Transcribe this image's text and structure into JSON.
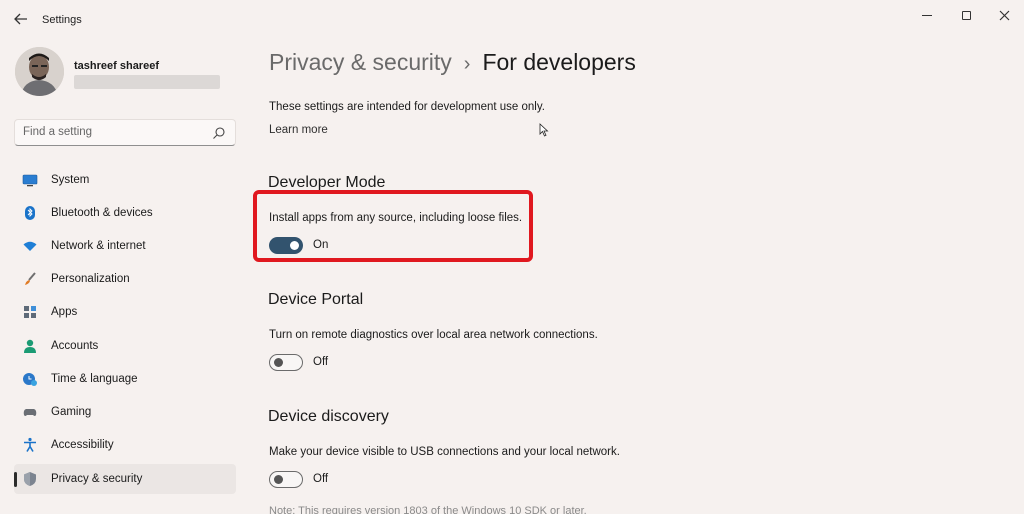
{
  "window": {
    "title": "Settings",
    "back_icon": "arrow-left-icon",
    "controls": [
      "minimize-icon",
      "maximize-icon",
      "close-icon"
    ]
  },
  "user": {
    "name": "tashreef shareef"
  },
  "search": {
    "placeholder": "Find a setting"
  },
  "sidebar": {
    "items": [
      {
        "label": "System",
        "icon": "monitor-icon"
      },
      {
        "label": "Bluetooth & devices",
        "icon": "bluetooth-icon"
      },
      {
        "label": "Network & internet",
        "icon": "wifi-icon"
      },
      {
        "label": "Personalization",
        "icon": "paintbrush-icon"
      },
      {
        "label": "Apps",
        "icon": "apps-icon"
      },
      {
        "label": "Accounts",
        "icon": "person-icon"
      },
      {
        "label": "Time & language",
        "icon": "clock-globe-icon"
      },
      {
        "label": "Gaming",
        "icon": "gamepad-icon"
      },
      {
        "label": "Accessibility",
        "icon": "accessibility-icon"
      },
      {
        "label": "Privacy & security",
        "icon": "shield-icon",
        "active": true
      }
    ]
  },
  "main": {
    "breadcrumb_parent": "Privacy & security",
    "breadcrumb_separator": "›",
    "breadcrumb_current": "For developers",
    "intro": "These settings are intended for development use only.",
    "learn_more": "Learn more",
    "sections": [
      {
        "title": "Developer Mode",
        "description": "Install apps from any source, including loose files.",
        "state": "On",
        "on": true
      },
      {
        "title": "Device Portal",
        "description": "Turn on remote diagnostics over local area network connections.",
        "state": "Off",
        "on": false
      },
      {
        "title": "Device discovery",
        "description": "Make your device visible to USB connections and your local network.",
        "state": "Off",
        "on": false
      }
    ],
    "footnote": "Note: This requires version 1803 of the Windows 10 SDK or later."
  },
  "colors": {
    "accent": "#32536e",
    "highlight": "#e0181f",
    "background": "#f6f1ef"
  }
}
